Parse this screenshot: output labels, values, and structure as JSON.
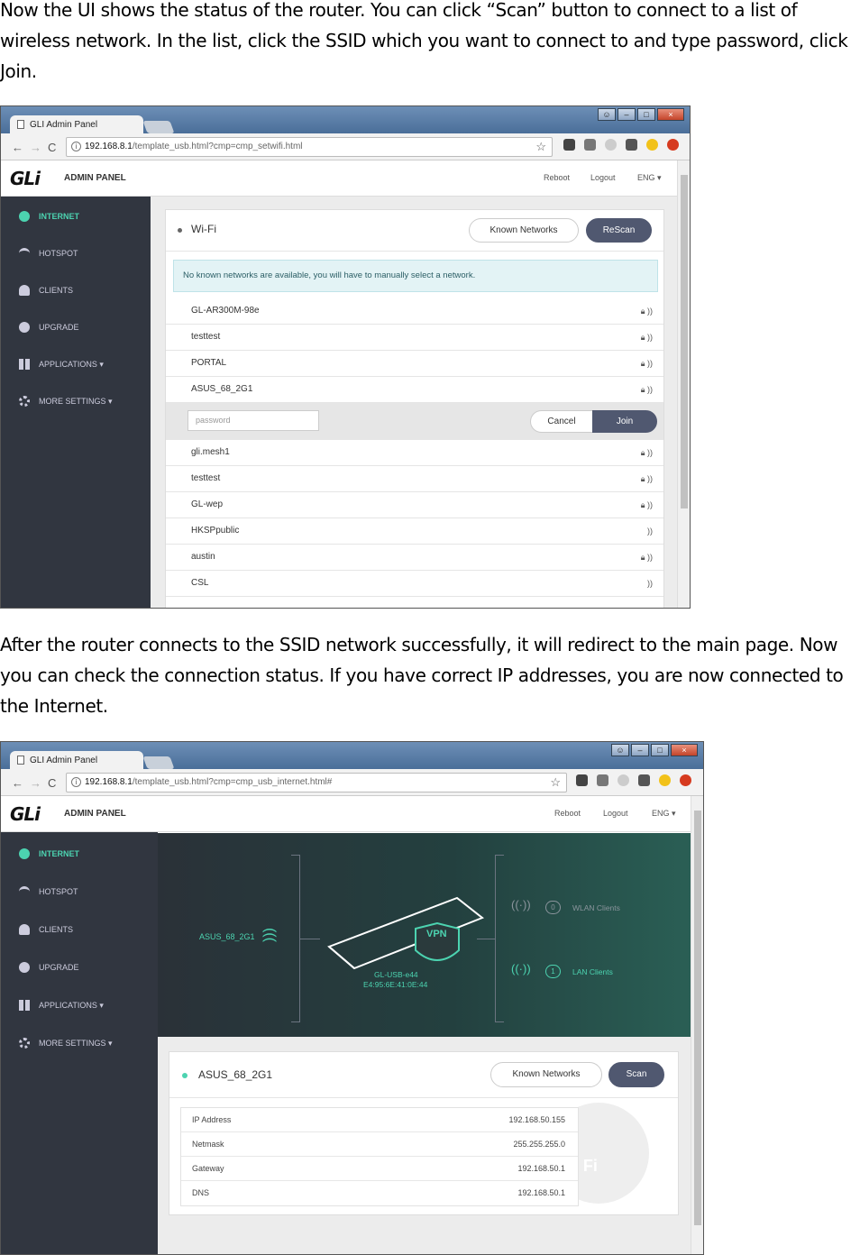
{
  "text": {
    "para1": "Now the UI shows the status of the router. You can click “Scan” button to connect to a list of wireless network.  In the list, click the SSID which you want to connect to and type password, click Join.",
    "para2": "After the router connects to the SSID network successfully, it will redirect to the main page. Now you can check the connection status. If you have correct IP addresses, you are now connected to the Internet."
  },
  "shot1": {
    "tab_title": "GLI Admin Panel",
    "url_host": "192.168.8.1",
    "url_path": "/template_usb.html?cmp=cmp_setwifi.html",
    "admin_panel": "ADMIN PANEL",
    "reboot": "Reboot",
    "logout": "Logout",
    "lang": "ENG ▾",
    "sidebar": [
      "INTERNET",
      "HOTSPOT",
      "CLIENTS",
      "UPGRADE",
      "APPLICATIONS ▾",
      "MORE SETTINGS ▾"
    ],
    "wifi_title": "Wi-Fi",
    "known_networks": "Known Networks",
    "rescan": "ReScan",
    "alert": "No known networks are available, you will have to manually select a network.",
    "networks_top": [
      "GL-AR300M-98e",
      "testtest",
      "PORTAL",
      "ASUS_68_2G1"
    ],
    "password_placeholder": "password",
    "cancel": "Cancel",
    "join": "Join",
    "networks_bottom": [
      "gli.mesh1",
      "testtest",
      "GL-wep",
      "HKSPpublic",
      "austin",
      "CSL"
    ]
  },
  "shot2": {
    "tab_title": "GLI Admin Panel",
    "url_host": "192.168.8.1",
    "url_path": "/template_usb.html?cmp=cmp_usb_internet.html#",
    "admin_panel": "ADMIN PANEL",
    "reboot": "Reboot",
    "logout": "Logout",
    "lang": "ENG ▾",
    "sidebar": [
      "INTERNET",
      "HOTSPOT",
      "CLIENTS",
      "UPGRADE",
      "APPLICATIONS ▾",
      "MORE SETTINGS ▾"
    ],
    "upstream_ssid": "ASUS_68_2G1",
    "device_name": "GL-USB-e44",
    "device_mac": "E4:95:6E:41:0E:44",
    "vpn_label": "VPN",
    "wlan_count": "0",
    "wlan_label": "WLAN Clients",
    "lan_count": "1",
    "lan_label": "LAN Clients",
    "card_ssid": "ASUS_68_2G1",
    "known_networks": "Known Networks",
    "scan": "Scan",
    "ip_rows": [
      {
        "label": "IP Address",
        "value": "192.168.50.155"
      },
      {
        "label": "Netmask",
        "value": "255.255.255.0"
      },
      {
        "label": "Gateway",
        "value": "192.168.50.1"
      },
      {
        "label": "DNS",
        "value": "192.168.50.1"
      }
    ],
    "wifi_badge": "Wi Fi"
  },
  "colors": {
    "accent": "#4cd3b0",
    "sidebar": "#313640",
    "button_dark": "#505870"
  }
}
